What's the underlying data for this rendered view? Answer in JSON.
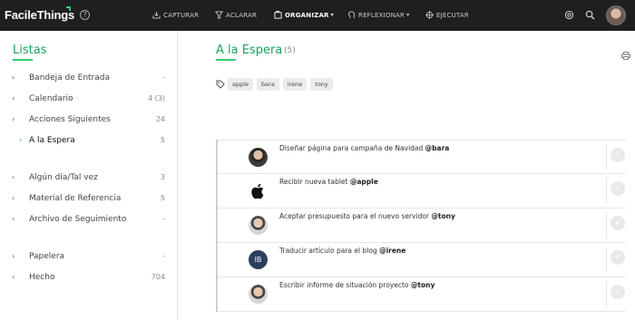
{
  "app": {
    "logo_text": "FacileThings"
  },
  "topnav": [
    {
      "label": "CAPTURAR",
      "icon": "inbox-icon",
      "active": false
    },
    {
      "label": "ACLARAR",
      "icon": "filter-icon",
      "active": false
    },
    {
      "label": "ORGANIZAR",
      "icon": "folders-icon",
      "active": true,
      "dropdown": true
    },
    {
      "label": "REFLEXIONAR",
      "icon": "thinking-icon",
      "active": false,
      "dropdown": true
    },
    {
      "label": "EJECUTAR",
      "icon": "target-icon",
      "active": false
    }
  ],
  "sidebar": {
    "title": "Listas",
    "items": [
      {
        "label": "Bandeja de Entrada",
        "count": "-"
      },
      {
        "label": "Calendario",
        "count": "4 (3)"
      },
      {
        "label": "Acciones Siguientes",
        "count": "24"
      },
      {
        "label": "A la Espera",
        "count": "5",
        "active": true
      },
      {
        "label": "Algún día/Tal vez",
        "count": "3"
      },
      {
        "label": "Material de Referencia",
        "count": "5"
      },
      {
        "label": "Archivo de Seguimiento",
        "count": "-"
      },
      {
        "label": "Papelera",
        "count": "-"
      },
      {
        "label": "Hecho",
        "count": "704"
      }
    ]
  },
  "main": {
    "title": "A la Espera",
    "count": "(5)",
    "tags": [
      "apple",
      "bara",
      "irene",
      "tony"
    ],
    "tasks": [
      {
        "text": "Diseñar página para campaña de Navidad ",
        "mention": "@bara",
        "avatar": "person"
      },
      {
        "text": "Recibir nueva tablet ",
        "mention": "@apple",
        "avatar": "apple"
      },
      {
        "text": "Aceptar presupuesto para el nuevo servidor ",
        "mention": "@tony",
        "avatar": "person2"
      },
      {
        "text": "Traducir artículo para el blog ",
        "mention": "@irene",
        "avatar": "IB"
      },
      {
        "text": "Escribir informe de situación proyecto ",
        "mention": "@tony",
        "avatar": "person2"
      }
    ]
  },
  "colors": {
    "accent": "#2ecc71",
    "title_green": "#1aa35c",
    "topbar": "#1f1f1f"
  }
}
